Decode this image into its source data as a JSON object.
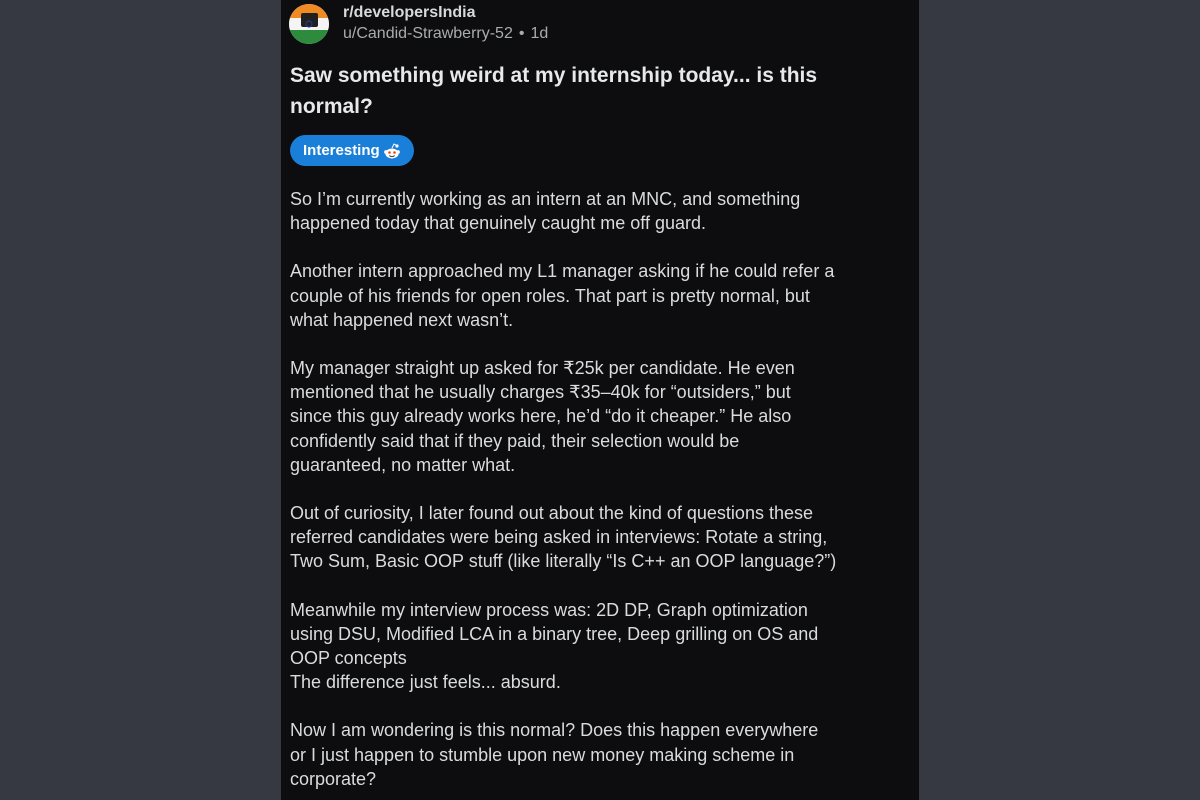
{
  "header": {
    "subreddit": "r/developersIndia",
    "author": "u/Candid-Strawberry-52",
    "separator": "•",
    "age": "1d"
  },
  "post": {
    "title_lines": [
      "Saw something weird at my internship today... is this",
      "normal?"
    ],
    "flair": {
      "label": "Interesting",
      "icon": "reddit-snoo-icon",
      "color": "#1a7fd8"
    },
    "paragraphs": [
      [
        "So I’m currently working as an intern at an MNC, and something",
        "happened today that genuinely caught me off guard."
      ],
      [
        "Another intern approached my L1 manager asking if he could refer a",
        "couple of his friends for open roles. That part is pretty normal, but",
        "what happened next wasn’t."
      ],
      [
        "My manager straight up asked for ₹25k per candidate. He even",
        "mentioned that he usually charges ₹35–40k for “outsiders,” but",
        "since this guy already works here, he’d “do it cheaper.” He also",
        "confidently said that if they paid, their selection would be",
        "guaranteed, no matter what."
      ],
      [
        "Out of curiosity, I later found out about the kind of questions these",
        "referred candidates were being asked in interviews: Rotate a string,",
        "Two Sum, Basic OOP stuff (like literally “Is C++ an OOP language?”)"
      ],
      [
        "Meanwhile my interview process was: 2D DP, Graph optimization",
        "using DSU, Modified LCA in a binary tree, Deep grilling on OS and",
        "OOP concepts",
        "The difference just feels... absurd."
      ],
      [
        "Now I am wondering is this normal? Does this happen everywhere",
        "or I just happen to stumble upon new money making scheme in",
        "corporate?"
      ]
    ]
  },
  "colors": {
    "page_background": "#363941",
    "post_background": "#0d0d0f",
    "text": "#d9dbdd",
    "flair": "#1a7fd8"
  },
  "icons": {
    "avatar": "india-flag-avatar-icon"
  }
}
